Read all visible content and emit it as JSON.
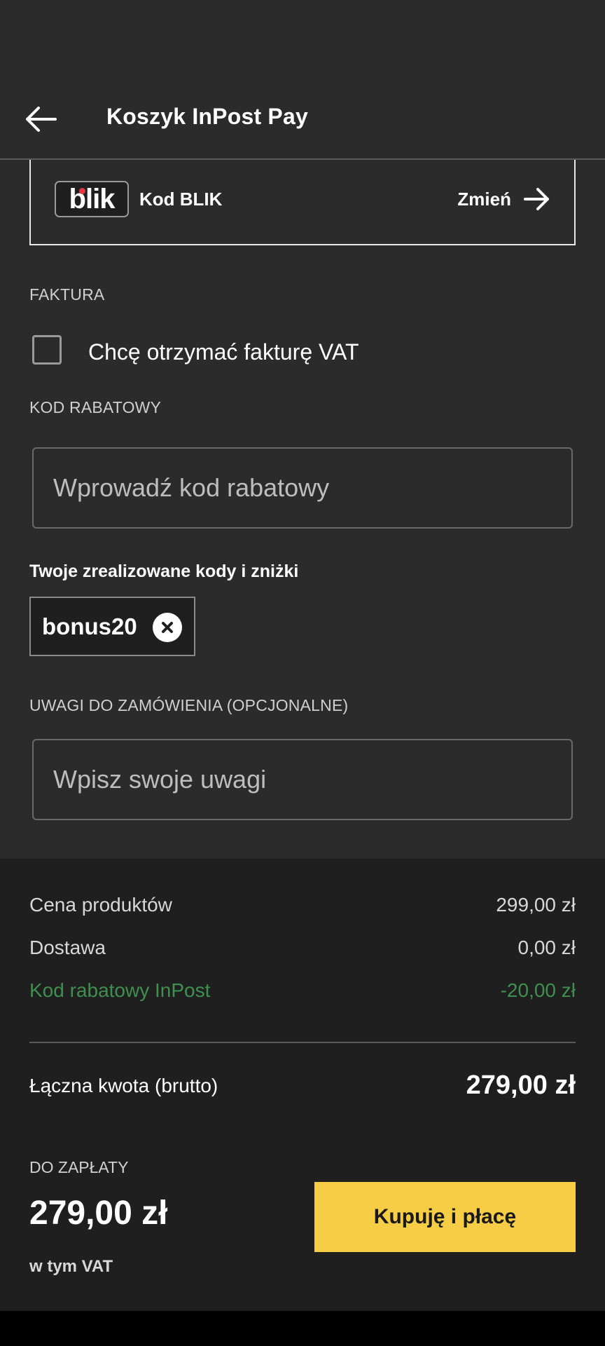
{
  "header": {
    "title": "Koszyk InPost Pay"
  },
  "payment": {
    "logo_text": "blik",
    "method_label": "Kod BLIK",
    "change_label": "Zmień"
  },
  "invoice": {
    "section_label": "FAKTURA",
    "checkbox_label": "Chcę otrzymać fakturę VAT",
    "checked": false
  },
  "discount": {
    "section_label": "KOD RABATOWY",
    "placeholder": "Wprowadź kod rabatowy",
    "value": "",
    "applied_title": "Twoje zrealizowane kody i zniżki",
    "applied_codes": [
      "bonus20"
    ]
  },
  "notes": {
    "section_label": "UWAGI DO ZAMÓWIENIA (OPCJONALNE)",
    "placeholder": "Wpisz swoje uwagi",
    "value": ""
  },
  "summary": {
    "rows": [
      {
        "label": "Cena produktów",
        "value": "299,00 zł"
      },
      {
        "label": "Dostawa",
        "value": "0,00 zł"
      },
      {
        "label": "Kod rabatowy InPost",
        "value": "-20,00 zł"
      }
    ],
    "total_label": "Łączna kwota (brutto)",
    "total_value": "279,00 zł",
    "pay_label": "DO ZAPŁATY",
    "pay_amount": "279,00 zł",
    "vat_note": "w tym VAT",
    "buy_label": "Kupuję i płacę"
  },
  "colors": {
    "accent": "#f7cd46",
    "discount": "#3f8f4f",
    "background": "#2b2b2b",
    "summary_background": "#1f1f1f"
  },
  "icons": {
    "back": "arrow-left-icon",
    "change": "arrow-right-icon",
    "remove": "close-circle-icon"
  }
}
